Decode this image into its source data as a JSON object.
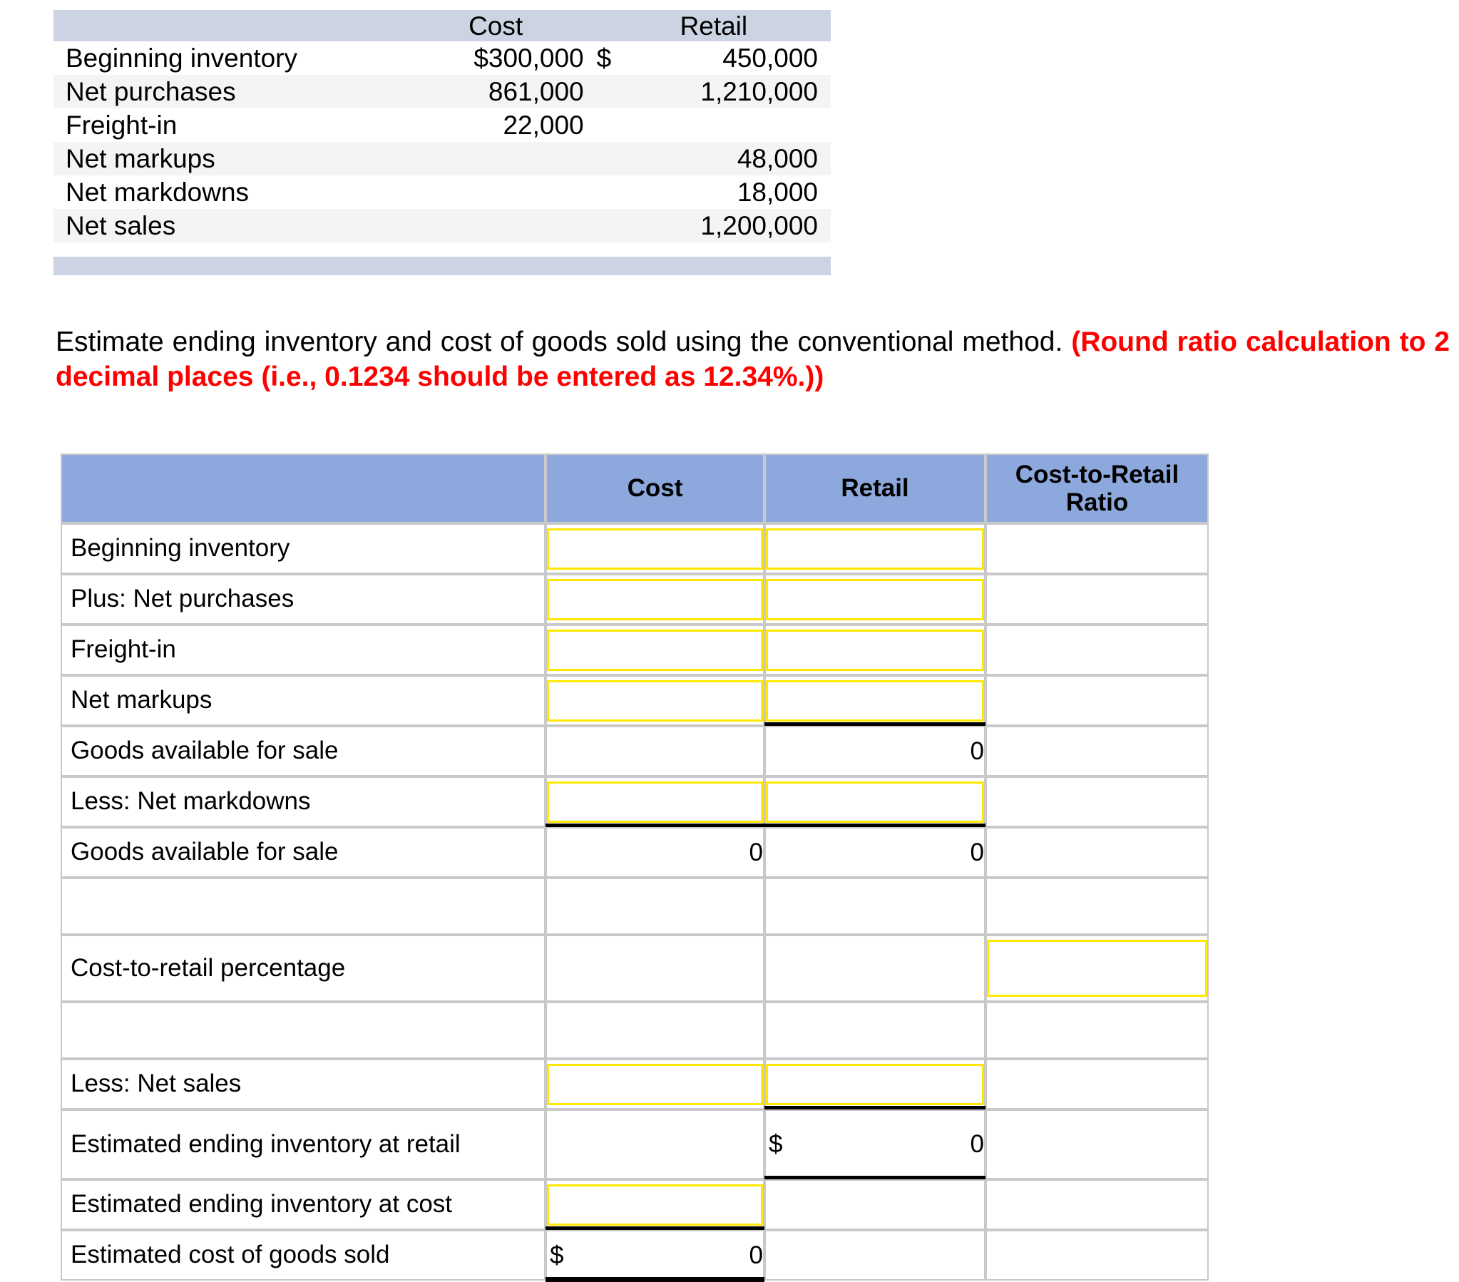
{
  "given_table": {
    "headers": [
      "",
      "Cost",
      "Retail"
    ],
    "rows": [
      {
        "label": "Beginning inventory",
        "cost": "$300,000",
        "retail_dollar": "$",
        "retail": "450,000",
        "shade": false
      },
      {
        "label": "Net purchases",
        "cost": "861,000",
        "retail_dollar": "",
        "retail": "1,210,000",
        "shade": true
      },
      {
        "label": "Freight-in",
        "cost": "22,000",
        "retail_dollar": "",
        "retail": "",
        "shade": false
      },
      {
        "label": "Net markups",
        "cost": "",
        "retail_dollar": "",
        "retail": "48,000",
        "shade": true
      },
      {
        "label": "Net markdowns",
        "cost": "",
        "retail_dollar": "",
        "retail": "18,000",
        "shade": false
      },
      {
        "label": "Net sales",
        "cost": "",
        "retail_dollar": "",
        "retail": "1,200,000",
        "shade": true
      }
    ]
  },
  "instruction": {
    "plain": "Estimate ending inventory and cost of goods sold using the conventional method. ",
    "highlight": "(Round ratio calculation to 2 decimal places (i.e., 0.1234 should be entered as 12.34%.))",
    "highlight_color": "#ff0000"
  },
  "answer_table": {
    "headers": {
      "blank": "",
      "cost": "Cost",
      "retail": "Retail",
      "ratio": "Cost-to-Retail Ratio",
      "ratio_line1": "Cost-to-Retail",
      "ratio_line2": "Ratio"
    },
    "header_bg": "#8ca8dc",
    "input_border": "#ffe800",
    "result_bg": "#fdf7ac",
    "rows": [
      {
        "label": "Beginning inventory"
      },
      {
        "label": "Plus: Net purchases"
      },
      {
        "label": "Freight-in"
      },
      {
        "label": "Net markups"
      },
      {
        "label": "Goods available for sale",
        "retail_value": "0"
      },
      {
        "label": "Less: Net markdowns"
      },
      {
        "label": "Goods available for sale",
        "cost_value": "0",
        "retail_value": "0"
      },
      {
        "label": ""
      },
      {
        "label": "Cost-to-retail percentage"
      },
      {
        "label": ""
      },
      {
        "label": "Less: Net sales"
      },
      {
        "label": "Estimated ending inventory at retail",
        "retail_dollar": "$",
        "retail_value": "0"
      },
      {
        "label": "Estimated ending inventory at cost"
      },
      {
        "label": "Estimated cost of goods sold",
        "cost_dollar": "$",
        "cost_value": "0"
      }
    ]
  }
}
